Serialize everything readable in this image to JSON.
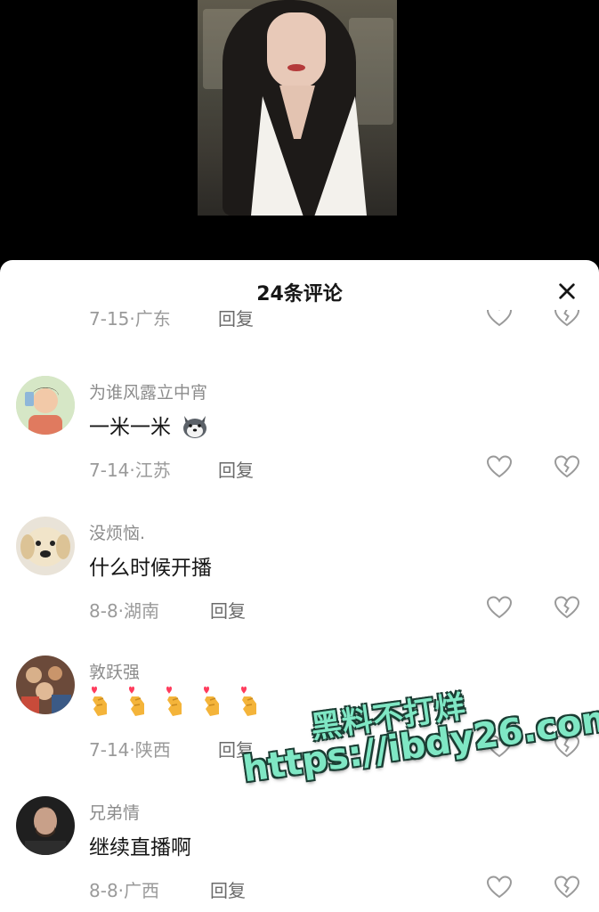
{
  "header": {
    "title": "24条评论"
  },
  "partial_row": {
    "meta": "7-15·广东",
    "reply": "回复"
  },
  "comments": [
    {
      "username": "为谁风露立中宵",
      "text": "一米一米",
      "meta": "7-14·江苏",
      "reply": "回复",
      "emoji": "dog-emoji"
    },
    {
      "username": "没烦恼.",
      "text": "什么时候开播",
      "meta": "8-8·湖南",
      "reply": "回复"
    },
    {
      "username": "敦跃强",
      "text": "",
      "meta": "7-14·陕西",
      "reply": "回复",
      "emoji": "finger-heart-emoji",
      "emoji_count": 5
    },
    {
      "username": "兄弟情",
      "text": "继续直播啊",
      "meta": "8-8·广西",
      "reply": "回复"
    }
  ],
  "watermark": {
    "line1": "黑料不打烊",
    "line2": "https://ibdy26.com"
  },
  "icons": {
    "like": "heart-outline-icon",
    "dislike": "broken-heart-icon",
    "close": "close-icon"
  },
  "colors": {
    "accent_watermark": "#7fe7c4",
    "text_primary": "#161616",
    "text_secondary": "#8c8c8c"
  }
}
